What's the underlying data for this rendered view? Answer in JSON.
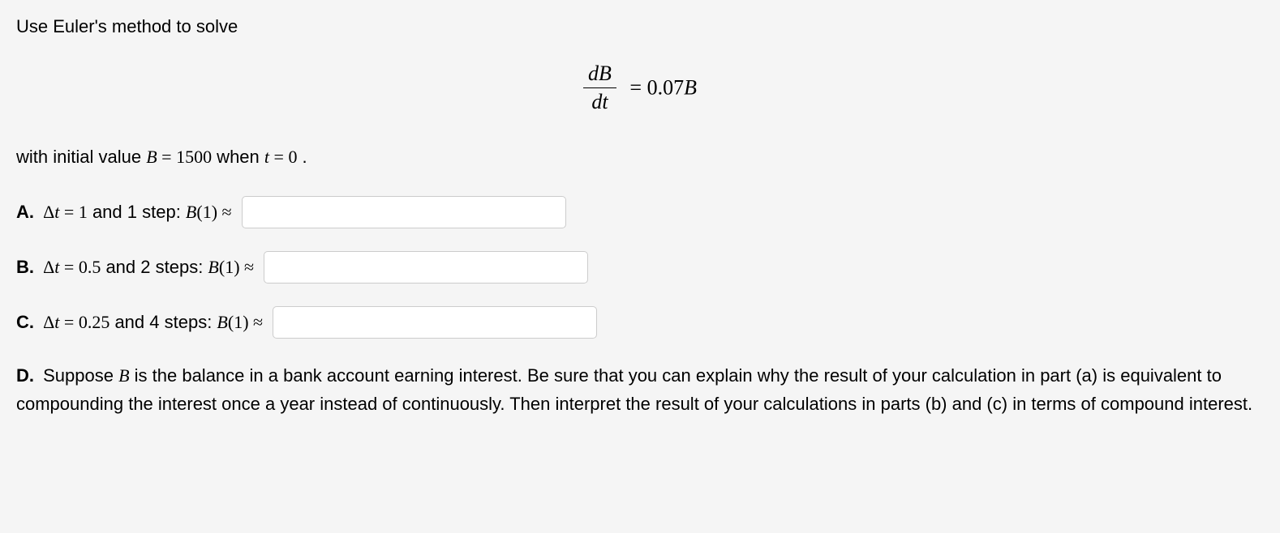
{
  "intro": "Use Euler's method to solve",
  "equation": {
    "numerator": "dB",
    "denominator": "dt",
    "equals": "=",
    "rhs_coeff": "0.07",
    "rhs_var": "B"
  },
  "initial": {
    "prefix": "with initial value ",
    "var_B": "B",
    "eq1": " = ",
    "val_B": "1500",
    "when": " when ",
    "var_t": "t",
    "eq2": " = ",
    "val_t": "0",
    "suffix": " ."
  },
  "parts": {
    "a": {
      "label": "A.",
      "delta": "Δ",
      "var_t": "t",
      "eq": " = ",
      "dt_val": "1",
      "and_steps": " and 1 step: ",
      "var_B": "B",
      "arg": "(1)",
      "approx": " ≈ "
    },
    "b": {
      "label": "B.",
      "delta": "Δ",
      "var_t": "t",
      "eq": " = ",
      "dt_val": "0.5",
      "and_steps": " and 2 steps: ",
      "var_B": "B",
      "arg": "(1)",
      "approx": " ≈ "
    },
    "c": {
      "label": "C.",
      "delta": "Δ",
      "var_t": "t",
      "eq": " = ",
      "dt_val": "0.25",
      "and_steps": " and 4 steps: ",
      "var_B": "B",
      "arg": "(1)",
      "approx": " ≈ "
    },
    "d": {
      "label": "D.",
      "text_before_B": " Suppose ",
      "var_B": "B",
      "text_after_B": " is the balance in a bank account earning interest. Be sure that you can explain why the result of your calculation in part (a) is equivalent to compounding the interest once a year instead of continuously. Then interpret the result of your calculations in parts (b) and (c) in terms of compound interest."
    }
  }
}
